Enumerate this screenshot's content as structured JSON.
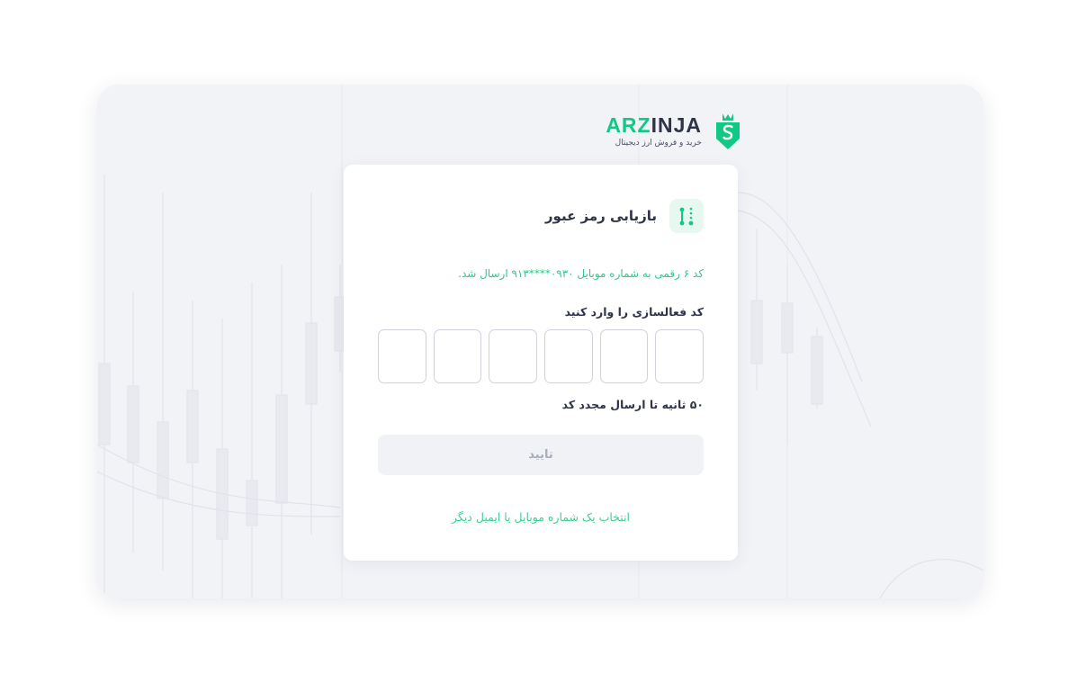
{
  "brand": {
    "name_accent": "ARZ",
    "name_rest": "INJA",
    "tagline": "خرید و فروش ارز دیجیتال",
    "accent_color": "#12c886"
  },
  "card": {
    "title": "بازیابی رمز عبور",
    "header_icon": "key-dots-icon",
    "sent_message": "کد ۶ رقمی به شماره موبایل ۰۹۳۰****۹۱۳ ارسال شد.",
    "code_label": "کد فعالسازی را وارد کنید",
    "otp_digits": [
      "",
      "",
      "",
      "",
      "",
      ""
    ],
    "timer_text": "۵۰ ثانیه تا ارسال مجدد کد",
    "confirm_label": "تایید",
    "alt_link": "انتخاب یک شماره موبایل یا ایمیل دیگر"
  }
}
